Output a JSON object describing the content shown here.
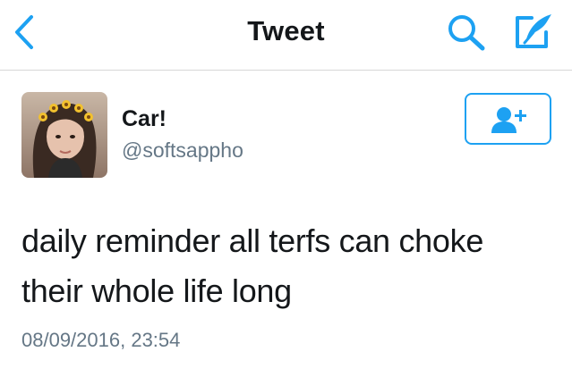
{
  "nav": {
    "title": "Tweet",
    "back_icon": "chevron-left-icon",
    "search_icon": "search-icon",
    "compose_icon": "compose-icon"
  },
  "tweet": {
    "author": {
      "name": "Car!",
      "handle": "@softsappho"
    },
    "follow_icon": "add-user-icon",
    "text": "daily reminder all terfs can choke their whole life long",
    "timestamp": "08/09/2016, 23:54"
  },
  "colors": {
    "accent": "#1da1f2",
    "text": "#14171a",
    "secondary_text": "#657786",
    "divider": "#d7d7d7"
  }
}
